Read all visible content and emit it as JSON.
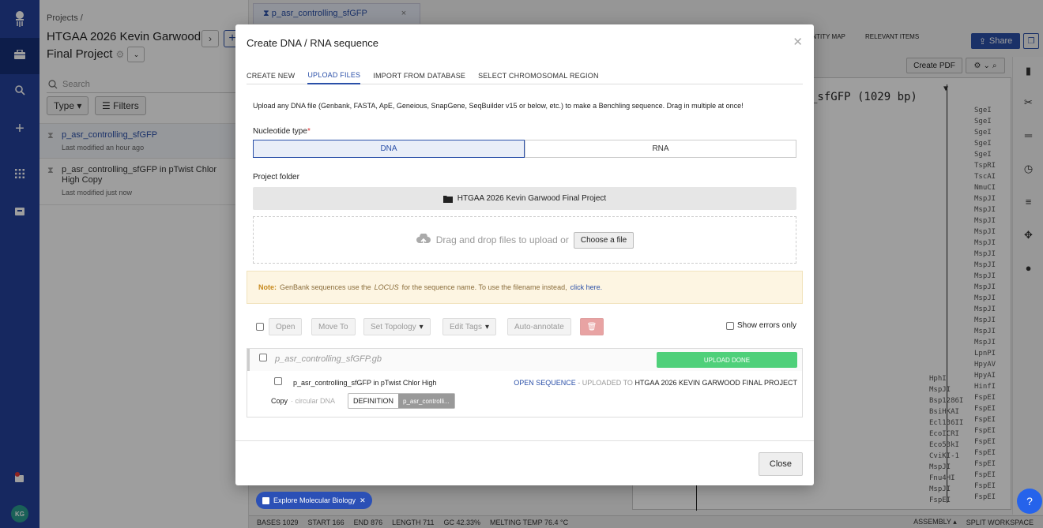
{
  "nav": {
    "initials": "KG"
  },
  "project": {
    "breadcrumb": "Projects /",
    "title": "HTGAA 2026 Kevin Garwood Final Project",
    "search_placeholder": "Search",
    "type_filter": "Type",
    "filters_label": "Filters",
    "items": [
      {
        "name": "p_asr_controlling_sfGFP",
        "modified": "Last modified an hour ago"
      },
      {
        "name": "p_asr_controlling_sfGFP in pTwist Chlor High Copy",
        "modified": "Last modified just now"
      }
    ]
  },
  "workspace": {
    "tab_label": "p_asr_controlling_sfGFP",
    "top_tabs": [
      "ENTITY MAP",
      "RELEVANT ITEMS"
    ],
    "share": "Share",
    "create_pdf": "Create PDF",
    "seq_title": "_sfGFP (1029 bp)",
    "enzymes_right": [
      "SgeI",
      "SgeI",
      "SgeI",
      "SgeI",
      "SgeI",
      "TspRI",
      "TscAI",
      "NmuCI",
      "MspJI",
      "MspJI",
      "MspJI",
      "MspJI",
      "MspJI",
      "MspJI",
      "MspJI",
      "MspJI",
      "MspJI",
      "MspJI",
      "MspJI",
      "MspJI",
      "MspJI",
      "MspJI",
      "LpnPI",
      "HpyAV",
      "HpyAI",
      "HinfI",
      "FspEI",
      "FspEI",
      "FspEI",
      "FspEI",
      "FspEI",
      "FspEI",
      "FspEI",
      "FspEI",
      "FspEI",
      "FspEI"
    ],
    "enzymes_left": [
      "HphI",
      "MspJI",
      "Bsp1286I",
      "BsiHKAI",
      "Ecl136II",
      "EcoICRI",
      "Eco53kI",
      "CviKI-1",
      "MspJI",
      "Fnu4HI",
      "MspJI",
      "FspEI"
    ],
    "status": [
      "BASES 1029",
      "START 166",
      "END 876",
      "LENGTH 711",
      "GC 42.33%",
      "MELTING TEMP 76.4 °C"
    ],
    "assembly": "ASSEMBLY",
    "split": "SPLIT WORKSPACE",
    "explore": "Explore Molecular Biology"
  },
  "modal": {
    "title": "Create DNA / RNA sequence",
    "tabs": [
      "CREATE NEW",
      "UPLOAD FILES",
      "IMPORT FROM DATABASE",
      "SELECT CHROMOSOMAL REGION"
    ],
    "intro": "Upload any DNA file (Genbank, FASTA, ApE, Geneious, SnapGene, SeqBuilder v15 or below, etc.) to make a Benchling sequence. Drag in multiple at once!",
    "nucleotide_label": "Nucleotide type",
    "dna": "DNA",
    "rna": "RNA",
    "folder_label": "Project folder",
    "folder_value": "HTGAA 2026 Kevin Garwood Final Project",
    "drag_text": "Drag and drop files to upload or",
    "choose": "Choose a file",
    "note_label": "Note:",
    "note_text1": "GenBank sequences use the",
    "note_locus": "LOCUS",
    "note_text2": "for the sequence name. To use the filename instead,",
    "note_link": "click here.",
    "toolbar": {
      "open": "Open",
      "move": "Move To",
      "topology": "Set Topology",
      "tags": "Edit Tags",
      "annotate": "Auto-annotate",
      "show_errors": "Show errors only"
    },
    "file": {
      "name": "p_asr_controlling_sfGFP.gb",
      "status": "UPLOAD DONE",
      "seq_name": "p_asr_controlling_sfGFP in pTwist Chlor High",
      "open_seq": "OPEN SEQUENCE",
      "uploaded_to": "- UPLOADED TO",
      "dest": "HTGAA 2026 KEVIN GARWOOD FINAL PROJECT",
      "copy": "Copy",
      "circular": "· circular DNA",
      "def_key": "DEFINITION",
      "def_val": "p_asr_controlli..."
    },
    "close": "Close"
  }
}
